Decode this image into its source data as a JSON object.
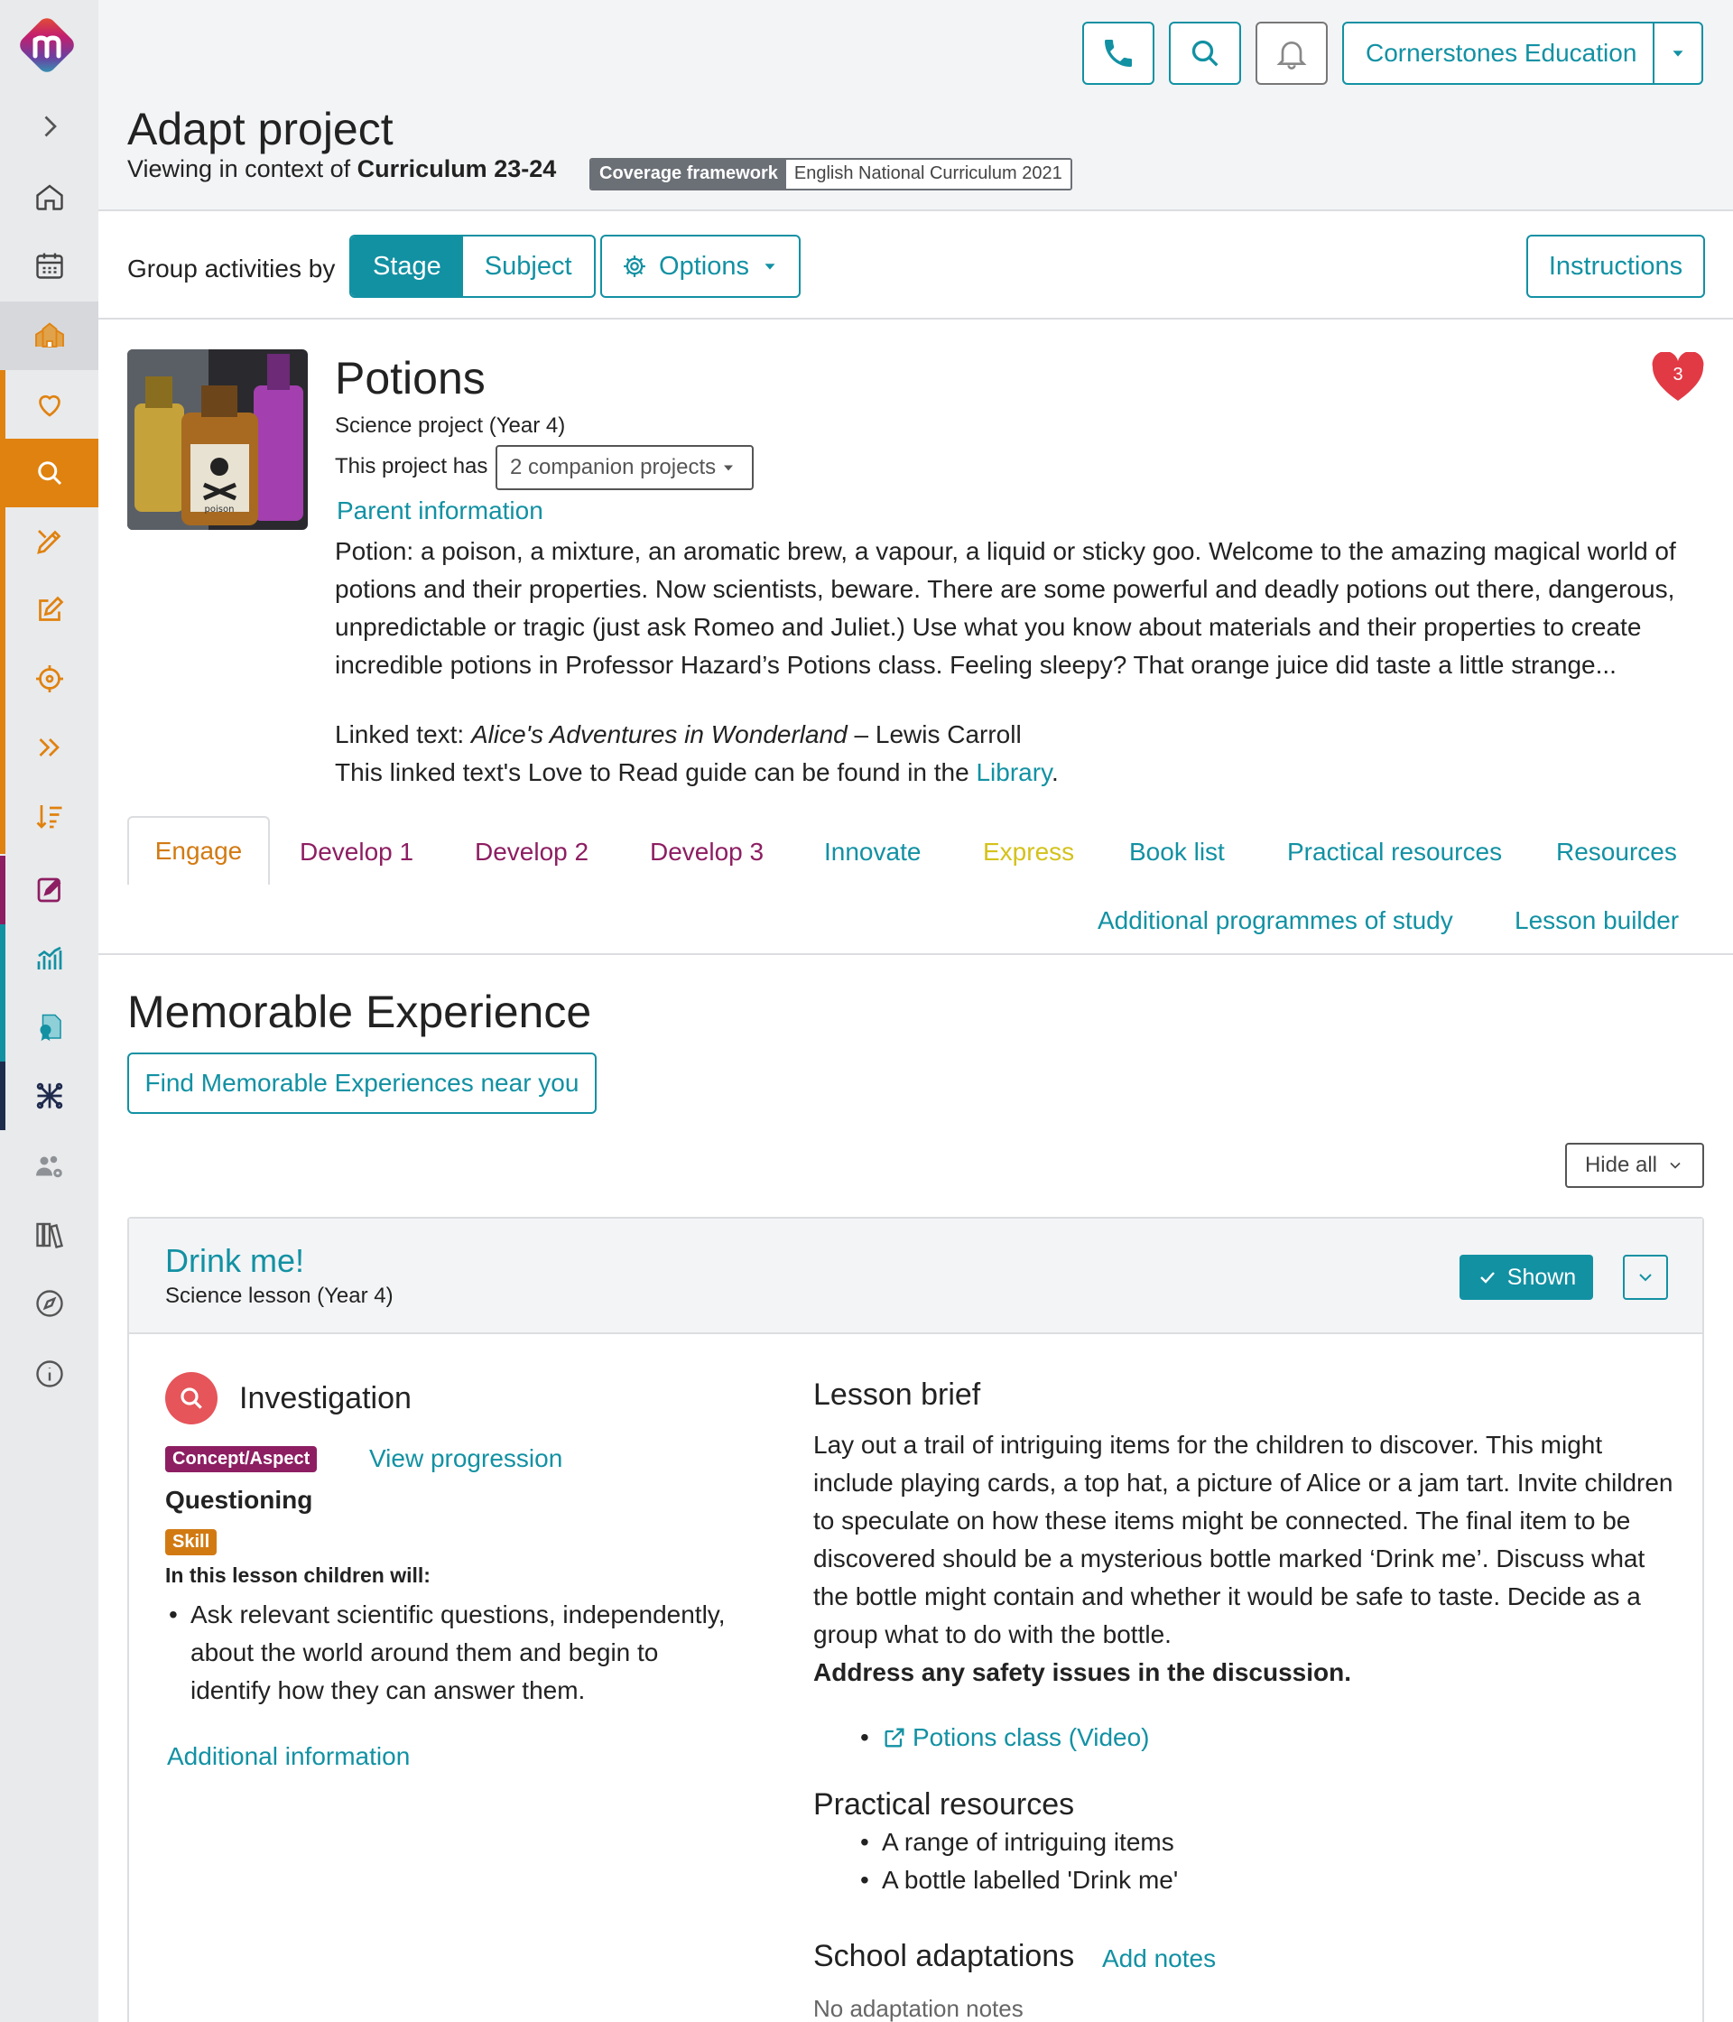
{
  "header": {
    "title": "Adapt project",
    "context_prefix": "Viewing in context of",
    "context_curriculum": "Curriculum 23-24",
    "coverage_label": "Coverage framework",
    "coverage_value": "English National Curriculum 2021",
    "org_name": "Cornerstones Education"
  },
  "toolbar": {
    "group_label": "Group activities by",
    "stage_label": "Stage",
    "subject_label": "Subject",
    "options_label": "Options",
    "instructions_label": "Instructions"
  },
  "project": {
    "title": "Potions",
    "subtitle": "Science project (Year 4)",
    "has_label": "This project has",
    "companion_label": "2 companion projects",
    "parent_info": "Parent information",
    "description": "Potion: a poison, a mixture, an aromatic brew, a vapour, a liquid or sticky goo. Welcome to the amazing magical world of potions and their properties. Now scientists, beware. There are some powerful and deadly potions out there, dangerous, unpredictable or tragic (just ask Romeo and Juliet.) Use what you know about materials and their properties to create incredible potions in Professor Hazard’s Potions class. Feeling sleepy? That orange juice did taste a little strange...",
    "linked_prefix": "Linked text:",
    "linked_title": "Alice's Adventures in Wonderland",
    "linked_author": "– Lewis Carroll",
    "guide_prefix": "This linked text's Love to Read guide can be found in the",
    "guide_link": "Library",
    "guide_suffix": ".",
    "favourite_count": "3",
    "thumb_label": "poison"
  },
  "tabs": [
    {
      "label": "Engage",
      "color": "#d27a12"
    },
    {
      "label": "Develop 1",
      "color": "#8d1e62"
    },
    {
      "label": "Develop 2",
      "color": "#8d1e62"
    },
    {
      "label": "Develop 3",
      "color": "#8d1e62"
    },
    {
      "label": "Innovate",
      "color": "#1291a3"
    },
    {
      "label": "Express",
      "color": "#d4c21c"
    },
    {
      "label": "Book list",
      "color": "#1291a3"
    },
    {
      "label": "Practical resources",
      "color": "#1291a3"
    },
    {
      "label": "Resources",
      "color": "#1291a3"
    },
    {
      "label": "Additional programmes of study",
      "color": "#1291a3"
    },
    {
      "label": "Lesson builder",
      "color": "#1291a3"
    }
  ],
  "section": {
    "title": "Memorable Experience",
    "find_button": "Find Memorable Experiences near you",
    "hide_all": "Hide all"
  },
  "lesson": {
    "title": "Drink me!",
    "subtitle": "Science lesson (Year 4)",
    "shown_label": "Shown",
    "activity_type": "Investigation",
    "concept_badge": "Concept/Aspect",
    "view_progression": "View progression",
    "concept_value": "Questioning",
    "skill_badge": "Skill",
    "children_will": "In this lesson children will:",
    "objectives": [
      "Ask relevant scientific questions, independently, about the world around them and begin to identify how they can answer them."
    ],
    "additional_info": "Additional information",
    "brief_title": "Lesson brief",
    "brief_text": "Lay out a trail of intriguing items for the children to discover. This might include playing cards, a top hat, a picture of Alice or a jam tart. Invite children to speculate on how these items might be connected. The final item to be discovered should be a mysterious bottle marked ‘Drink me’. Discuss what the bottle might contain and whether it would be safe to taste. Decide as a group what to do with the bottle.",
    "brief_bold": "Address any safety issues in the discussion.",
    "video_link": "Potions class (Video)",
    "practical_title": "Practical resources",
    "practical_items": [
      "A range of intriguing items",
      "A bottle labelled 'Drink me'"
    ],
    "adaptations_title": "School adaptations",
    "add_notes": "Add notes",
    "no_notes": "No adaptation notes"
  },
  "colors": {
    "accent": "#1291a3",
    "orange": "#e0820f",
    "purple": "#8d1e62",
    "dark": "#1f2b4d"
  }
}
